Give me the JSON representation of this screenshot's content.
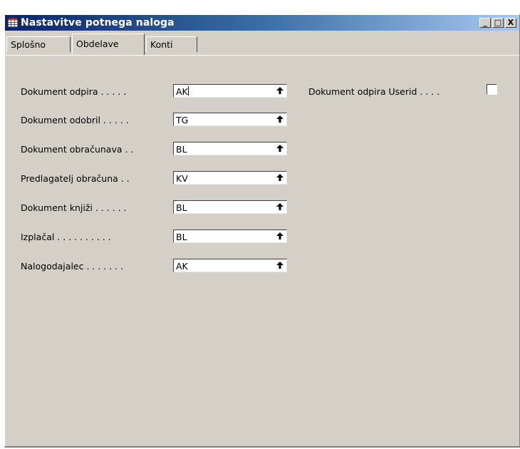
{
  "window": {
    "title": "Nastavitve potnega naloga",
    "buttons": {
      "minimize": "_",
      "maximize": "□",
      "close": "X"
    }
  },
  "tabs": [
    {
      "label": "Splošno",
      "active": false
    },
    {
      "label": "Obdelave",
      "active": true
    },
    {
      "label": "Konti",
      "active": false
    }
  ],
  "fields": [
    {
      "label": "Dokument odpira . . . . .",
      "value": "AK"
    },
    {
      "label": "Dokument odobril . . . . .",
      "value": "TG"
    },
    {
      "label": "Dokument obračunava . .",
      "value": "BL"
    },
    {
      "label": "Predlagatelj obračuna . .",
      "value": "KV"
    },
    {
      "label": "Dokument knjiži . . . . . .",
      "value": "BL"
    },
    {
      "label": "Izplačal . . . . . . . . . .",
      "value": "BL"
    },
    {
      "label": "Nalogodajalec . . . . . . .",
      "value": "AK"
    }
  ],
  "userid_checkbox": {
    "label": "Dokument odpira Userid . . . .",
    "checked": false
  },
  "icons": {
    "title": "table-icon",
    "lookup": "arrow-up-icon"
  }
}
